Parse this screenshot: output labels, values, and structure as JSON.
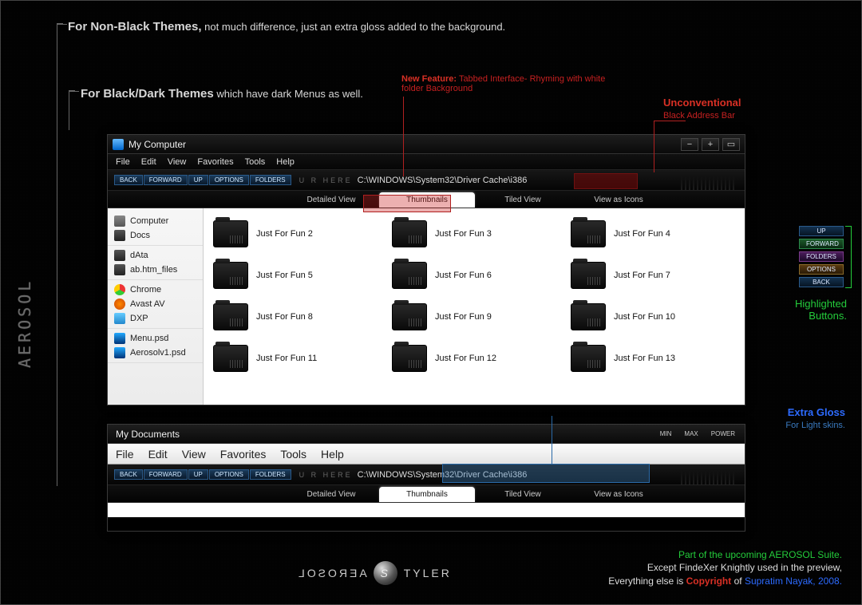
{
  "annotations": {
    "nonblack_b": "For Non-Black Themes,",
    "nonblack_rest": " not much difference, just an extra gloss added to the background.",
    "dark_b": "For Black/Dark Themes",
    "dark_rest": " which have dark Menus as well.",
    "newfeat_b": "New Feature:",
    "newfeat_rest": " Tabbed Interface- Rhyming with white folder Background",
    "unconv1": "Unconventional",
    "unconv2": "Black Address Bar",
    "hl_title": "Highlighted",
    "hl_title2": "Buttons.",
    "gloss_b": "Extra Gloss",
    "gloss_rest": "For Light skins."
  },
  "side_logo": "AEROSOL",
  "win1": {
    "title": "My Computer",
    "menus": [
      "File",
      "Edit",
      "View",
      "Favorites",
      "Tools",
      "Help"
    ],
    "nav": [
      "BACK",
      "FORWARD",
      "UP",
      "OPTIONS",
      "FOLDERS"
    ],
    "urhere": "U R HERE",
    "path": "C:\\WINDOWS\\System32\\Driver Cache\\i386",
    "tabs": [
      "Detailed View",
      "Thumbnails",
      "Tiled View",
      "View as Icons"
    ],
    "active_tab": 1,
    "ctrl": {
      "min": "−",
      "max": "+",
      "close": "▭"
    },
    "sidebar": [
      [
        {
          "icon": "ic-drive",
          "label": "Computer"
        },
        {
          "icon": "ic-folder",
          "label": "Docs"
        }
      ],
      [
        {
          "icon": "ic-folder",
          "label": "dAta"
        },
        {
          "icon": "ic-folder",
          "label": "ab.htm_files"
        }
      ],
      [
        {
          "icon": "ic-chrome",
          "label": "Chrome"
        },
        {
          "icon": "ic-avast",
          "label": "Avast AV"
        },
        {
          "icon": "ic-dxp",
          "label": "DXP"
        }
      ],
      [
        {
          "icon": "ic-psd",
          "label": "Menu.psd"
        },
        {
          "icon": "ic-psd",
          "label": "Aerosolv1.psd"
        }
      ]
    ],
    "folders": [
      "Just For Fun 2",
      "Just For Fun 3",
      "Just For Fun 4",
      "Just For Fun 5",
      "Just For Fun 6",
      "Just For Fun 7",
      "Just For Fun 8",
      "Just For Fun 9",
      "Just For Fun 10",
      "Just For Fun 11",
      "Just For Fun 12",
      "Just For Fun 13"
    ]
  },
  "win2": {
    "title": "My Documents",
    "ctrl": [
      "MIN",
      "MAX",
      "POWER"
    ],
    "menus": [
      "File",
      "Edit",
      "View",
      "Favorites",
      "Tools",
      "Help"
    ],
    "nav": [
      "BACK",
      "FORWARD",
      "UP",
      "OPTIONS",
      "FOLDERS"
    ],
    "urhere": "U R HERE",
    "path": "C:\\WINDOWS\\System32\\Driver Cache\\i386",
    "tabs": [
      "Detailed View",
      "Thumbnails",
      "Tiled View",
      "View as Icons"
    ],
    "active_tab": 1
  },
  "hl_buttons": [
    "UP",
    "FORWARD",
    "FOLDERS",
    "OPTIONS",
    "BACK"
  ],
  "footer": {
    "left": "AEROSOL",
    "right": "TYLER",
    "line1": "Part of the upcoming AEROSOL Suite.",
    "line2": "Except FindeXer Knightly used in the preview,",
    "line3a": "Everything else is ",
    "line3b": "Copyright",
    "line3c": " of ",
    "line3d": "Supratim Nayak, 2008."
  }
}
